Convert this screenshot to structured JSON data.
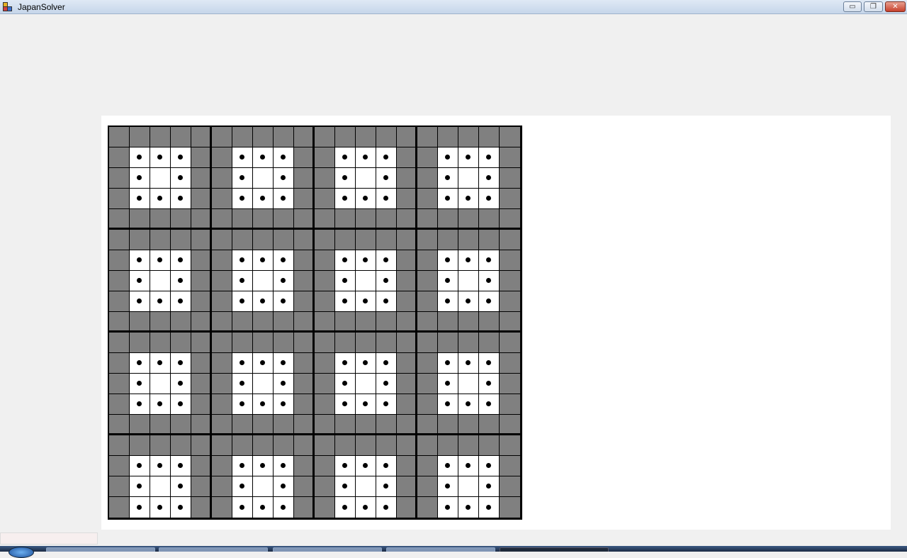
{
  "window": {
    "title": "JapanSolver",
    "min_glyph": "▭",
    "max_glyph": "❐",
    "close_glyph": "✕"
  },
  "puzzle": {
    "cols": 20,
    "rows": 19,
    "block_size": 5,
    "filled_color": "#808080",
    "empty_color": "#ffffff",
    "dot_mark": "•",
    "block_pattern": [
      [
        "F",
        "F",
        "F",
        "F",
        "F"
      ],
      [
        "F",
        "D",
        "D",
        "D",
        "F"
      ],
      [
        "F",
        "D",
        "E",
        "D",
        "F"
      ],
      [
        "F",
        "D",
        "D",
        "D",
        "F"
      ],
      [
        "F",
        "F",
        "F",
        "F",
        "F"
      ]
    ]
  },
  "taskbar": {
    "items": [
      "",
      "",
      "",
      "",
      ""
    ],
    "active_index": 4
  }
}
